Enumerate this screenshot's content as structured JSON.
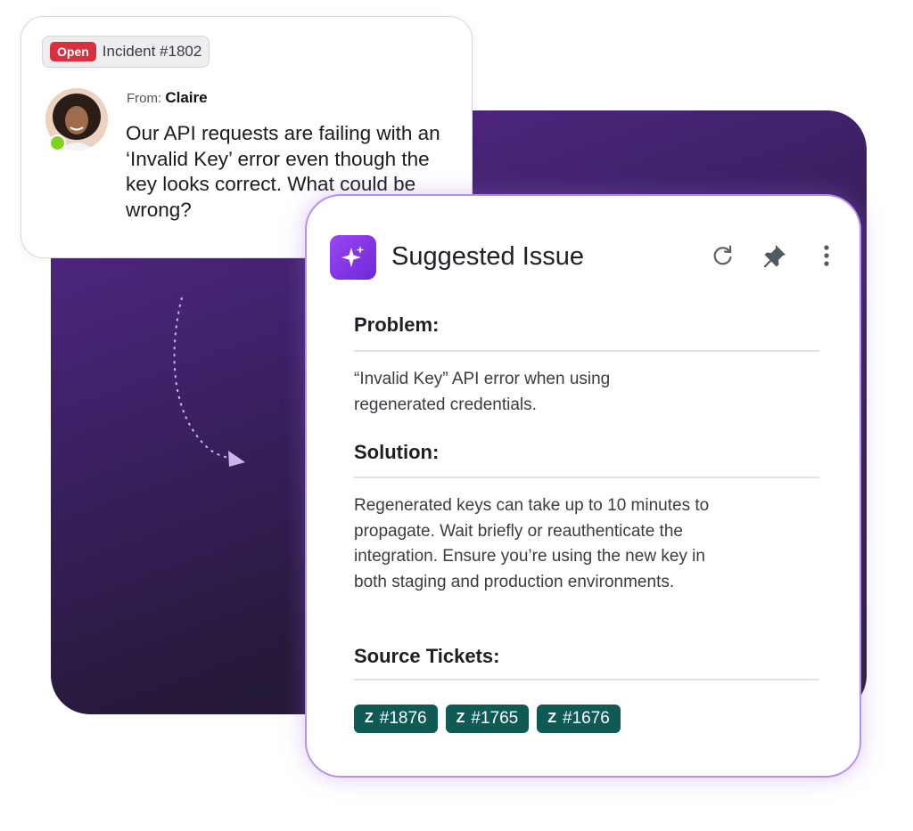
{
  "incident": {
    "status_badge": "Open",
    "number": "Incident #1802",
    "from_label": "From:",
    "from_name": "Claire",
    "message": "Our API requests are failing with an ‘Invalid Key’ error even though the key looks correct. What could be wrong?"
  },
  "suggestion": {
    "title": "Suggested Issue",
    "problem_heading": "Problem:",
    "problem_text": "“Invalid Key” API error when using regenerated credentials.",
    "solution_heading": "Solution:",
    "solution_text": "Regenerated keys can take up to 10 minutes to propagate. Wait briefly or reauthenticate the integration. Ensure you’re using the new key in both staging and production environments.",
    "sources_heading": "Source Tickets:",
    "tickets": [
      "#1876",
      "#1765",
      "#1676"
    ]
  },
  "icons": {
    "header": "sparkle-icon",
    "actions": [
      "refresh-icon",
      "pin-icon",
      "more-vertical-icon"
    ],
    "ticket": "zendesk-logo-icon"
  },
  "colors": {
    "accent": "#7c3aed",
    "open_badge": "#d9303e",
    "ticket_chip": "#0f5a55",
    "online_dot": "#7ed321"
  }
}
